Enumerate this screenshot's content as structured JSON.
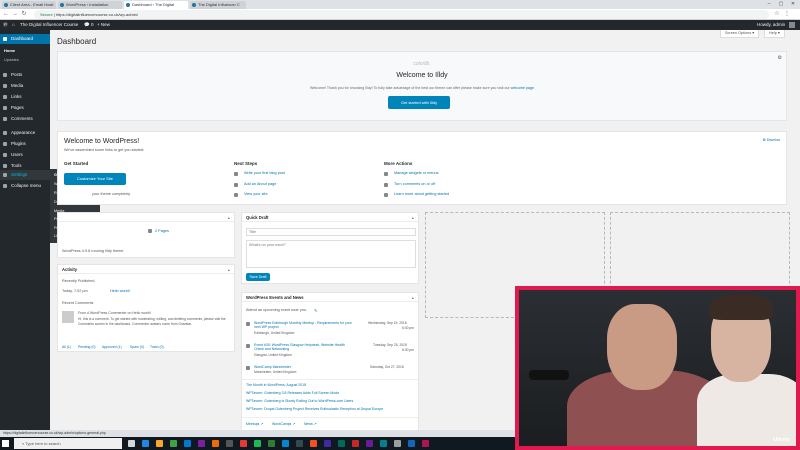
{
  "browser": {
    "tabs": [
      {
        "label": "Client Area - Email Hosti",
        "active": false
      },
      {
        "label": "WordPress › Installation",
        "active": false
      },
      {
        "label": "Dashboard ‹ The Digital",
        "active": true
      },
      {
        "label": "The Digital Influencer C",
        "active": false
      }
    ],
    "url_secure": "Secure",
    "url": "https://digitalinfluencercourse.co.uk/wp-admin/"
  },
  "adminbar": {
    "site_name": "The Digital Influencer Course",
    "comments_count": "0",
    "new_label": "+ New",
    "howdy": "Howdy, admin"
  },
  "sidebar": {
    "dashboard": "Dashboard",
    "home": "Home",
    "updates": "Updates",
    "items": [
      "Posts",
      "Media",
      "Links",
      "Pages",
      "Comments",
      "Appearance",
      "Plugins",
      "Users",
      "Tools",
      "Settings",
      "Collapse menu"
    ],
    "settings_flyout": [
      "General",
      "Writing",
      "Reading",
      "Discussion",
      "Media",
      "Permalinks",
      "Privacy",
      "Limit Login Attempts"
    ]
  },
  "header": {
    "title": "Dashboard",
    "screen_options": "Screen Options ▾",
    "help": "Help ▾"
  },
  "illdy": {
    "logo": "colorlib.",
    "title": "Welcome to Illdy",
    "text": "Welcome! Thank you for choosing Illdy! To fully take advantage of the best our theme can offer please make sure you visit our",
    "link": "welcome page",
    "button": "Get started with Illdy"
  },
  "welcome": {
    "title": "Welcome to WordPress!",
    "subtitle": "We've assembled some links to get you started:",
    "dismiss": "Dismiss",
    "get_started": "Get Started",
    "customize_button": "Customize Your Site",
    "or_text": "your theme completely",
    "next_steps_title": "Next Steps",
    "next_steps": [
      "Write your first blog post",
      "Add an About page",
      "View your site"
    ],
    "more_actions_title": "More Actions",
    "more_actions": [
      "Manage widgets or menus",
      "Turn comments on or off",
      "Learn more about getting started"
    ]
  },
  "at_a_glance": {
    "pages": "2 Pages",
    "version": "WordPress 4.9.8 running Illdy theme."
  },
  "activity": {
    "title": "Activity",
    "recently_published": "Recently Published",
    "post_date": "Today, 7:02 pm",
    "post_link": "Hello world!",
    "recent_comments": "Recent Comments",
    "comment_from": "From A WordPress Commenter on Hello world!",
    "comment_line1": "Hi, this is a comment. To get started with moderating, editing, and deleting comments, please visit the",
    "comment_line2": "Comments screen in the dashboard. Commenter avatars come from Gravatar.",
    "filters": [
      "All (1)",
      "Pending (0)",
      "Approved (1)",
      "Spam (0)",
      "Trash (0)"
    ]
  },
  "quick_draft": {
    "title": "Quick Draft",
    "title_placeholder": "Title",
    "content_placeholder": "What's on your mind?",
    "save_button": "Save Draft"
  },
  "events": {
    "title": "WordPress Events and News",
    "attend": "Attend an upcoming event near you.",
    "items": [
      {
        "name": "WordPress Edinburgh Monthly Meetup - Requirements for your next WP project",
        "place": "Edinburgh, United Kingdom",
        "date": "Wednesday, Sep 19, 2018",
        "time": "6:30 pm"
      },
      {
        "name": "Event #30: WordPress Glasgow Helpdesk, Website Health Check and Networking",
        "place": "Glasgow, United Kingdom",
        "date": "Tuesday, Sep 25, 2018",
        "time": "6:30 pm"
      },
      {
        "name": "WordCamp Manchester",
        "place": "Manchester, United Kingdom",
        "date": "Saturday, Oct 27, 2018",
        "time": ""
      }
    ],
    "news": [
      "The Month in WordPress: August 2018",
      "WPTavern: Gutenberg 3.8 Releases Adds Full Screen Mode",
      "WPTavern: Gutenberg is Slowly Rolling Out to WordPress.com Users",
      "WPTavern: Drupal Gutenberg Project Receives Enthusiastic Reception at Drupal Europe"
    ],
    "footer": [
      "Meetups ↗",
      "WordCamps ↗",
      "News ↗"
    ]
  },
  "statusbar": "https://digitalinfluencercourse.co.uk/wp-admin/options-general.php",
  "taskbar": {
    "search_placeholder": "Type here to search"
  },
  "watermark": "Udemy"
}
